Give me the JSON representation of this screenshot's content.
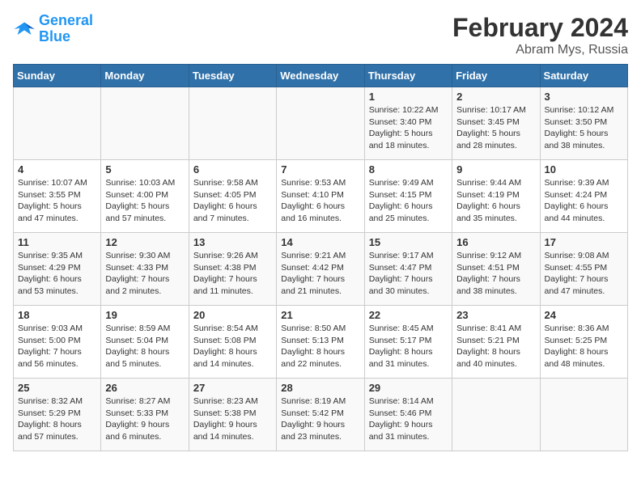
{
  "logo": {
    "line1": "General",
    "line2": "Blue"
  },
  "title": "February 2024",
  "subtitle": "Abram Mys, Russia",
  "weekdays": [
    "Sunday",
    "Monday",
    "Tuesday",
    "Wednesday",
    "Thursday",
    "Friday",
    "Saturday"
  ],
  "weeks": [
    [
      {
        "day": "",
        "text": ""
      },
      {
        "day": "",
        "text": ""
      },
      {
        "day": "",
        "text": ""
      },
      {
        "day": "",
        "text": ""
      },
      {
        "day": "1",
        "text": "Sunrise: 10:22 AM\nSunset: 3:40 PM\nDaylight: 5 hours\nand 18 minutes."
      },
      {
        "day": "2",
        "text": "Sunrise: 10:17 AM\nSunset: 3:45 PM\nDaylight: 5 hours\nand 28 minutes."
      },
      {
        "day": "3",
        "text": "Sunrise: 10:12 AM\nSunset: 3:50 PM\nDaylight: 5 hours\nand 38 minutes."
      }
    ],
    [
      {
        "day": "4",
        "text": "Sunrise: 10:07 AM\nSunset: 3:55 PM\nDaylight: 5 hours\nand 47 minutes."
      },
      {
        "day": "5",
        "text": "Sunrise: 10:03 AM\nSunset: 4:00 PM\nDaylight: 5 hours\nand 57 minutes."
      },
      {
        "day": "6",
        "text": "Sunrise: 9:58 AM\nSunset: 4:05 PM\nDaylight: 6 hours\nand 7 minutes."
      },
      {
        "day": "7",
        "text": "Sunrise: 9:53 AM\nSunset: 4:10 PM\nDaylight: 6 hours\nand 16 minutes."
      },
      {
        "day": "8",
        "text": "Sunrise: 9:49 AM\nSunset: 4:15 PM\nDaylight: 6 hours\nand 25 minutes."
      },
      {
        "day": "9",
        "text": "Sunrise: 9:44 AM\nSunset: 4:19 PM\nDaylight: 6 hours\nand 35 minutes."
      },
      {
        "day": "10",
        "text": "Sunrise: 9:39 AM\nSunset: 4:24 PM\nDaylight: 6 hours\nand 44 minutes."
      }
    ],
    [
      {
        "day": "11",
        "text": "Sunrise: 9:35 AM\nSunset: 4:29 PM\nDaylight: 6 hours\nand 53 minutes."
      },
      {
        "day": "12",
        "text": "Sunrise: 9:30 AM\nSunset: 4:33 PM\nDaylight: 7 hours\nand 2 minutes."
      },
      {
        "day": "13",
        "text": "Sunrise: 9:26 AM\nSunset: 4:38 PM\nDaylight: 7 hours\nand 11 minutes."
      },
      {
        "day": "14",
        "text": "Sunrise: 9:21 AM\nSunset: 4:42 PM\nDaylight: 7 hours\nand 21 minutes."
      },
      {
        "day": "15",
        "text": "Sunrise: 9:17 AM\nSunset: 4:47 PM\nDaylight: 7 hours\nand 30 minutes."
      },
      {
        "day": "16",
        "text": "Sunrise: 9:12 AM\nSunset: 4:51 PM\nDaylight: 7 hours\nand 38 minutes."
      },
      {
        "day": "17",
        "text": "Sunrise: 9:08 AM\nSunset: 4:55 PM\nDaylight: 7 hours\nand 47 minutes."
      }
    ],
    [
      {
        "day": "18",
        "text": "Sunrise: 9:03 AM\nSunset: 5:00 PM\nDaylight: 7 hours\nand 56 minutes."
      },
      {
        "day": "19",
        "text": "Sunrise: 8:59 AM\nSunset: 5:04 PM\nDaylight: 8 hours\nand 5 minutes."
      },
      {
        "day": "20",
        "text": "Sunrise: 8:54 AM\nSunset: 5:08 PM\nDaylight: 8 hours\nand 14 minutes."
      },
      {
        "day": "21",
        "text": "Sunrise: 8:50 AM\nSunset: 5:13 PM\nDaylight: 8 hours\nand 22 minutes."
      },
      {
        "day": "22",
        "text": "Sunrise: 8:45 AM\nSunset: 5:17 PM\nDaylight: 8 hours\nand 31 minutes."
      },
      {
        "day": "23",
        "text": "Sunrise: 8:41 AM\nSunset: 5:21 PM\nDaylight: 8 hours\nand 40 minutes."
      },
      {
        "day": "24",
        "text": "Sunrise: 8:36 AM\nSunset: 5:25 PM\nDaylight: 8 hours\nand 48 minutes."
      }
    ],
    [
      {
        "day": "25",
        "text": "Sunrise: 8:32 AM\nSunset: 5:29 PM\nDaylight: 8 hours\nand 57 minutes."
      },
      {
        "day": "26",
        "text": "Sunrise: 8:27 AM\nSunset: 5:33 PM\nDaylight: 9 hours\nand 6 minutes."
      },
      {
        "day": "27",
        "text": "Sunrise: 8:23 AM\nSunset: 5:38 PM\nDaylight: 9 hours\nand 14 minutes."
      },
      {
        "day": "28",
        "text": "Sunrise: 8:19 AM\nSunset: 5:42 PM\nDaylight: 9 hours\nand 23 minutes."
      },
      {
        "day": "29",
        "text": "Sunrise: 8:14 AM\nSunset: 5:46 PM\nDaylight: 9 hours\nand 31 minutes."
      },
      {
        "day": "",
        "text": ""
      },
      {
        "day": "",
        "text": ""
      }
    ]
  ]
}
